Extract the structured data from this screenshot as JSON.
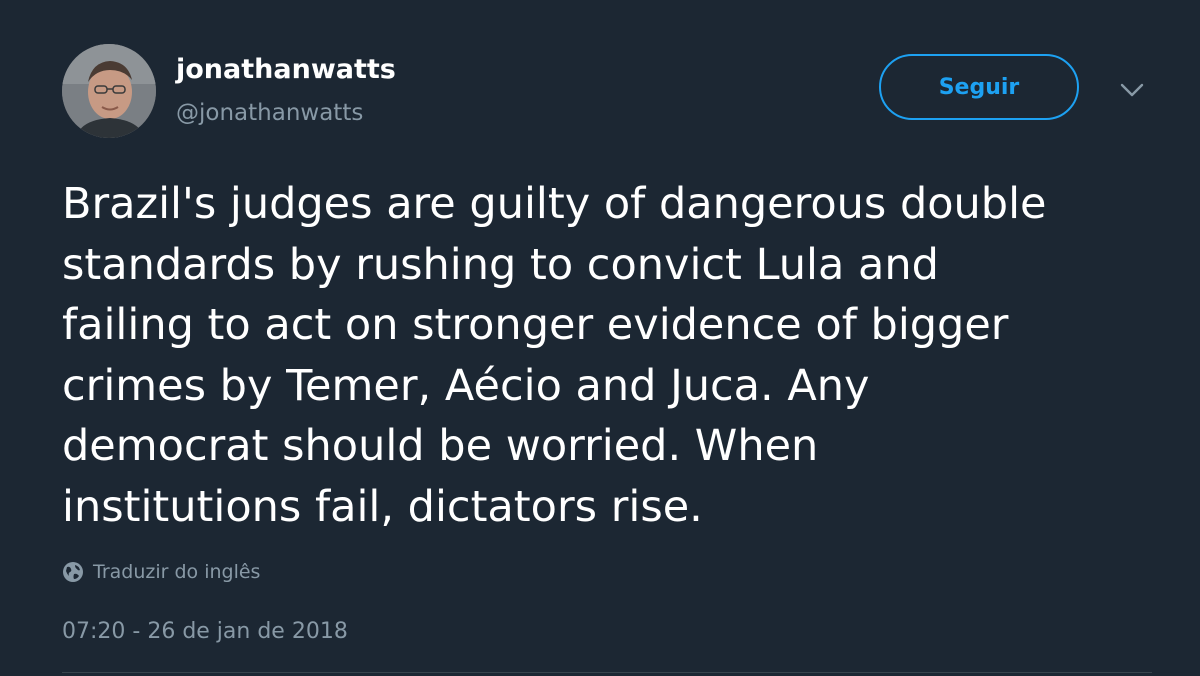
{
  "author": {
    "display_name": "jonathanwatts",
    "handle": "@jonathanwatts",
    "avatar_icon": "person-avatar"
  },
  "actions": {
    "follow_label": "Seguir",
    "menu_icon": "chevron-down-icon"
  },
  "tweet": {
    "text": "Brazil's judges are guilty of dangerous double\nstandards by rushing to convict Lula and\nfailing to act on stronger evidence of bigger\ncrimes by Temer, Aécio and Juca. Any\ndemocrat should be worried. When\ninstitutions fail, dictators rise.",
    "translate_label": "Traduzir do inglês",
    "translate_icon": "globe-icon",
    "timestamp": "07:20 - 26 de jan de 2018"
  },
  "colors": {
    "background": "#1c2733",
    "accent": "#1da1f2",
    "secondary_text": "#8899a6",
    "primary_text": "#ffffff"
  }
}
